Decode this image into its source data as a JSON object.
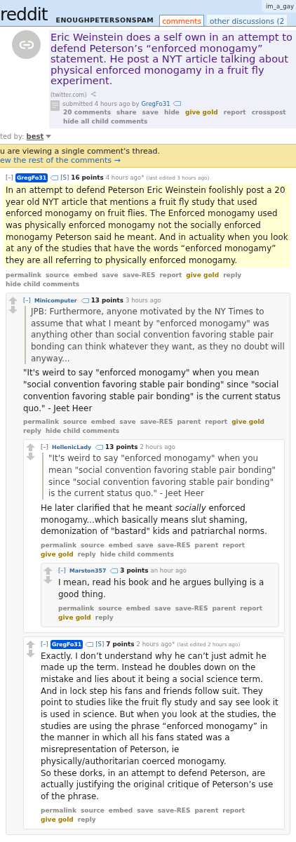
{
  "header": {
    "logo": "reddit",
    "subreddit": "ENOUGHPETERSONSPAM",
    "tabs": [
      {
        "label": "comments",
        "selected": true
      },
      {
        "label": "other discussions (2",
        "selected": false
      }
    ],
    "user": "im_a_gay"
  },
  "post": {
    "title": "Eric Weinstein does a self own in an attempt to defend Peterson’s “enforced monogamy” statement. He post a NYT article talking about physical enforced monogamy in a fruit fly experiment.",
    "domain": "(twitter.com)",
    "submitted": "submitted 4 hours ago by",
    "author": "GregFo31",
    "buttons": [
      {
        "label": "20 comments",
        "kind": "plain"
      },
      {
        "label": "share",
        "kind": "plain"
      },
      {
        "label": "save",
        "kind": "plain"
      },
      {
        "label": "hide",
        "kind": "plain"
      },
      {
        "label": "give gold",
        "kind": "gold"
      },
      {
        "label": "report",
        "kind": "plain"
      },
      {
        "label": "crosspost",
        "kind": "plain"
      },
      {
        "label": "hide all child comments",
        "kind": "plain"
      }
    ]
  },
  "sort": {
    "label": "ted by:",
    "value": "best"
  },
  "notice": {
    "text": "u are viewing a single comment's thread.",
    "link": "ew the rest of the comments →"
  },
  "comments": [
    {
      "toggle": "[–]",
      "author": "GregFo31",
      "op": true,
      "submitter": "[S]",
      "points": "16 points",
      "time": "4 hours ago*",
      "edited": "(last edited 3 hours ago)",
      "highlighted": true,
      "blocks": [
        {
          "kind": "text",
          "text": "In an attempt to defend Peterson Eric Weinstein foolishly post a 20 year old NYT article that mentions a fruit fly study that used enforced monogamy on fruit flies. The Enforced monogamy used was physically enforced monogamy not the socially enforced monogamy Peterson said he meant. And in actuality when you look at any of the studies that have the words “enforced monogamy” they are all referring to physically enforced monogamy."
        }
      ],
      "actions": [
        {
          "label": "permalink",
          "kind": "plain"
        },
        {
          "label": "source",
          "kind": "plain"
        },
        {
          "label": "embed",
          "kind": "plain"
        },
        {
          "label": "save",
          "kind": "plain"
        },
        {
          "label": "save-RES",
          "kind": "plain"
        },
        {
          "label": "report",
          "kind": "plain"
        },
        {
          "label": "give gold",
          "kind": "gold"
        },
        {
          "label": "reply",
          "kind": "plain"
        },
        {
          "label": "hide child comments",
          "kind": "plain"
        }
      ],
      "children": [
        {
          "toggle": "[–]",
          "author": "Minicomputer",
          "op": false,
          "points": "13 points",
          "time": "3 hours ago",
          "highlighted": false,
          "blocks": [
            {
              "kind": "quote",
              "text": "JPB: Furthermore, anyone motivated by the NY Times to assume that what I meant by \"enforced monogamy\" was anything other than social convention favoring stable pair bonding can think whatever they want, as they no doubt will anyway..."
            },
            {
              "kind": "text",
              "text": "\"It's weird to say \"enforced monogamy\" when you mean \"social convention favoring stable pair bonding\" since \"social convention favoring stable pair bonding\" is the current status quo.\" - Jeet Heer"
            }
          ],
          "actions": [
            {
              "label": "permalink",
              "kind": "plain"
            },
            {
              "label": "source",
              "kind": "plain"
            },
            {
              "label": "embed",
              "kind": "plain"
            },
            {
              "label": "save",
              "kind": "plain"
            },
            {
              "label": "save-RES",
              "kind": "plain"
            },
            {
              "label": "parent",
              "kind": "plain"
            },
            {
              "label": "report",
              "kind": "plain"
            },
            {
              "label": "give gold",
              "kind": "gold"
            },
            {
              "label": "reply",
              "kind": "plain"
            },
            {
              "label": "hide child comments",
              "kind": "plain"
            }
          ],
          "children": [
            {
              "toggle": "[–]",
              "author": "HellenicLady",
              "op": false,
              "points": "13 points",
              "time": "2 hours ago",
              "highlighted": false,
              "blocks": [
                {
                  "kind": "quote",
                  "text": "\"It's weird to say \"enforced monogamy\" when you mean \"social convention favoring stable pair bonding\" since \"social convention favoring stable pair bonding\" is the current status quo.\" - Jeet Heer"
                },
                {
                  "kind": "text",
                  "text": "He later clarified that he meant *socially* enforced monogamy...which basically means slut shaming, demonization of \"bastard\" kids and patriarchal norms."
                }
              ],
              "actions": [
                {
                  "label": "permalink",
                  "kind": "plain"
                },
                {
                  "label": "source",
                  "kind": "plain"
                },
                {
                  "label": "embed",
                  "kind": "plain"
                },
                {
                  "label": "save",
                  "kind": "plain"
                },
                {
                  "label": "save-RES",
                  "kind": "plain"
                },
                {
                  "label": "parent",
                  "kind": "plain"
                },
                {
                  "label": "report",
                  "kind": "plain"
                },
                {
                  "label": "give gold",
                  "kind": "gold"
                },
                {
                  "label": "reply",
                  "kind": "plain"
                },
                {
                  "label": "hide child comments",
                  "kind": "plain"
                }
              ],
              "children": [
                {
                  "toggle": "[–]",
                  "author": "Marston357",
                  "op": false,
                  "points": "3 points",
                  "time": "an hour ago",
                  "highlighted": false,
                  "blocks": [
                    {
                      "kind": "text",
                      "text": "I mean, read his book and he argues bullying is a good thing."
                    }
                  ],
                  "actions": [
                    {
                      "label": "permalink",
                      "kind": "plain"
                    },
                    {
                      "label": "source",
                      "kind": "plain"
                    },
                    {
                      "label": "embed",
                      "kind": "plain"
                    },
                    {
                      "label": "save",
                      "kind": "plain"
                    },
                    {
                      "label": "save-RES",
                      "kind": "plain"
                    },
                    {
                      "label": "parent",
                      "kind": "plain"
                    },
                    {
                      "label": "report",
                      "kind": "plain"
                    },
                    {
                      "label": "give gold",
                      "kind": "gold"
                    },
                    {
                      "label": "reply",
                      "kind": "plain"
                    }
                  ]
                }
              ]
            },
            {
              "toggle": "[–]",
              "author": "GregFo31",
              "op": true,
              "submitter": "[S]",
              "points": "7 points",
              "time": "2 hours ago*",
              "edited": "(last edited 2 hours ago)",
              "highlighted": false,
              "blocks": [
                {
                  "kind": "text",
                  "text": "Exactly. I don’t understand why he can’t just admit he made up the term. Instead he doubles down on the mistake and lies about it being a social science term. And in lock step his fans and friends follow suit. They point to studies like the fruit fly study and say see look it is used in science. But when you look at the studies, the studies are using the phrase “enforced monogamy” in the manner in which all his fans stated was a misrepresentation of Peterson, ie physically/authoritarian coerced monogamy.\nSo these dorks, in an attempt to defend Peterson, are actually justifying the original critique of Peterson’s use of the phrase."
                }
              ],
              "actions": [
                {
                  "label": "permalink",
                  "kind": "plain"
                },
                {
                  "label": "source",
                  "kind": "plain"
                },
                {
                  "label": "embed",
                  "kind": "plain"
                },
                {
                  "label": "save",
                  "kind": "plain"
                },
                {
                  "label": "save-RES",
                  "kind": "plain"
                },
                {
                  "label": "parent",
                  "kind": "plain"
                },
                {
                  "label": "report",
                  "kind": "plain"
                },
                {
                  "label": "give gold",
                  "kind": "gold"
                },
                {
                  "label": "reply",
                  "kind": "plain"
                }
              ]
            }
          ]
        }
      ]
    }
  ]
}
